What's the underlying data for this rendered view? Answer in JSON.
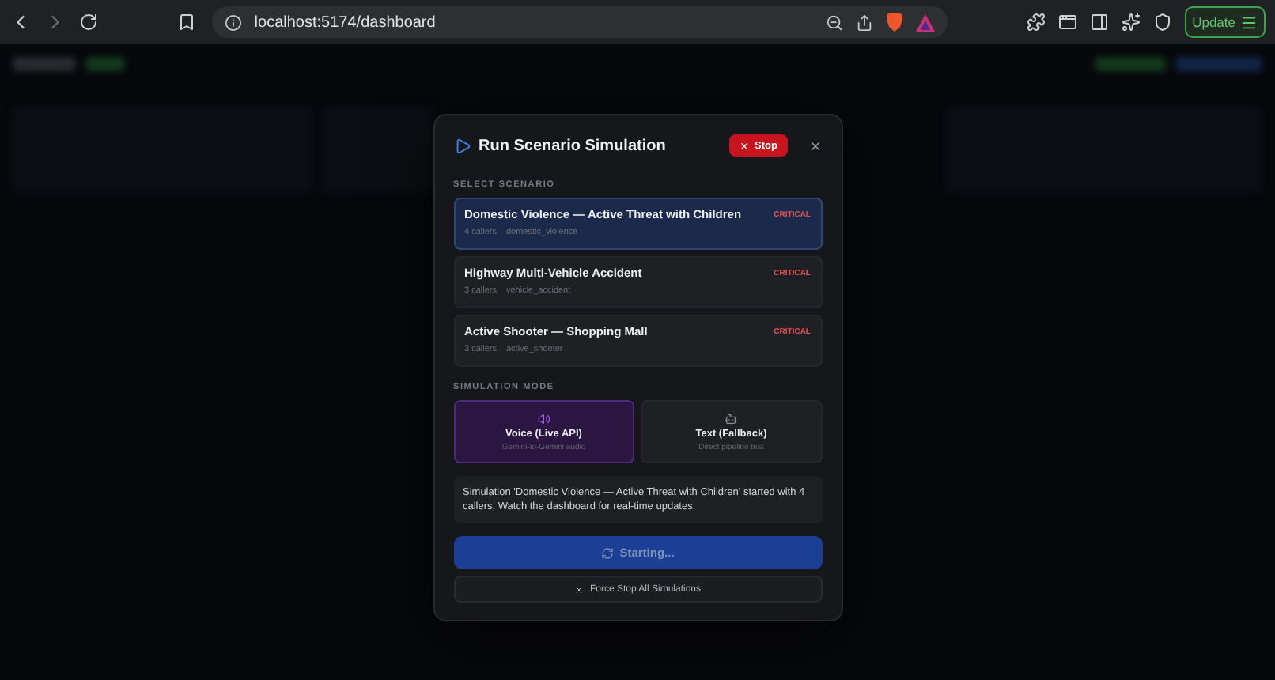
{
  "browser": {
    "url": "localhost:5174/dashboard",
    "update_label": "Update"
  },
  "modal": {
    "title": "Run Scenario Simulation",
    "stop_label": "Stop",
    "scenario_heading": "SELECT SCENARIO",
    "scenarios": [
      {
        "title": "Domestic Violence — Active Threat with Children",
        "callers": "4 callers",
        "id": "domestic_violence",
        "severity": "CRITICAL",
        "selected": true
      },
      {
        "title": "Highway Multi-Vehicle Accident",
        "callers": "3 callers",
        "id": "vehicle_accident",
        "severity": "CRITICAL",
        "selected": false
      },
      {
        "title": "Active Shooter — Shopping Mall",
        "callers": "3 callers",
        "id": "active_shooter",
        "severity": "CRITICAL",
        "selected": false
      }
    ],
    "mode_heading": "SIMULATION MODE",
    "modes": [
      {
        "kind": "voice",
        "label": "Voice (Live API)",
        "sublabel": "Gemini-to-Gemini audio",
        "selected": true
      },
      {
        "kind": "text",
        "label": "Text (Fallback)",
        "sublabel": "Direct pipeline test",
        "selected": false
      }
    ],
    "message": "Simulation 'Domestic Violence — Active Threat with Children' started with 4 callers. Watch the dashboard for real-time updates.",
    "start_button": {
      "label": "Starting...",
      "busy": true
    },
    "force_stop_label": "Force Stop All Simulations"
  }
}
